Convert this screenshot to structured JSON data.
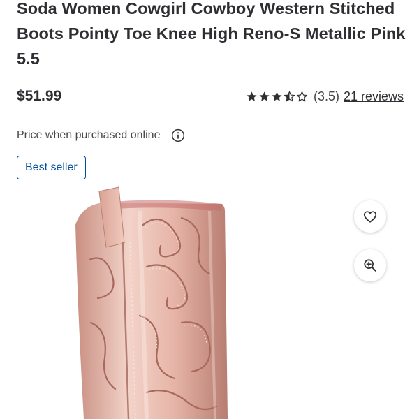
{
  "product": {
    "title": "Soda Women Cowgirl Cowboy Western Stitched Boots Pointy Toe Knee High Reno-S Metallic Pink 5.5",
    "price": "$51.99",
    "rating": {
      "stars": 3.5,
      "value_text": "(3.5)",
      "reviews_label": "21 reviews"
    },
    "price_note": "Price when purchased online",
    "badge": "Best seller"
  },
  "image": {
    "alt": "Metallic pink western stitched cowboy boot"
  },
  "icons": {
    "info": "info-icon",
    "favorite": "heart-icon",
    "zoom": "zoom-in-icon",
    "star": "star-icon"
  },
  "colors": {
    "text": "#2e2f32",
    "link_blue": "#004f9a",
    "boot_pink": "#e7b9ad"
  }
}
